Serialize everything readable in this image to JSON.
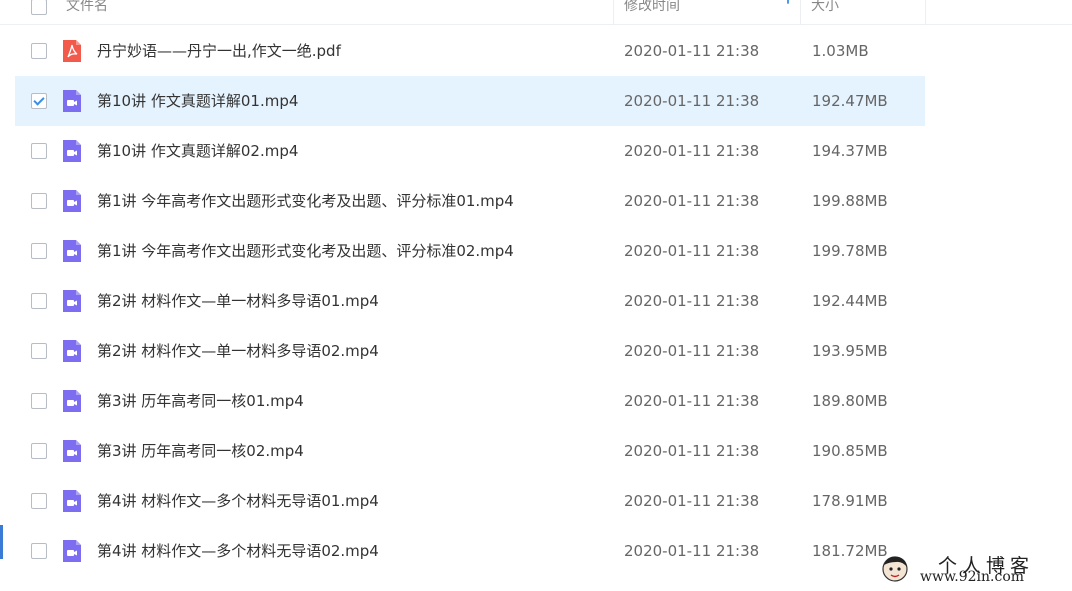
{
  "header": {
    "name_label": "文件名",
    "modified_label": "修改时间",
    "size_label": "大小"
  },
  "colors": {
    "selected_row": "#e5f3ff",
    "pdf_icon": "#f25a4c",
    "video_icon": "#7d6df0",
    "checkmark": "#3a8ee6"
  },
  "files": [
    {
      "name": "丹宁妙语——丹宁一出,作文一绝.pdf",
      "modified": "2020-01-11 21:38",
      "size": "1.03MB",
      "icon": "pdf-icon",
      "selected": false
    },
    {
      "name": "第10讲 作文真题详解01.mp4",
      "modified": "2020-01-11 21:38",
      "size": "192.47MB",
      "icon": "video-icon",
      "selected": true
    },
    {
      "name": "第10讲 作文真题详解02.mp4",
      "modified": "2020-01-11 21:38",
      "size": "194.37MB",
      "icon": "video-icon",
      "selected": false
    },
    {
      "name": "第1讲 今年高考作文出题形式变化考及出题、评分标准01.mp4",
      "modified": "2020-01-11 21:38",
      "size": "199.88MB",
      "icon": "video-icon",
      "selected": false
    },
    {
      "name": "第1讲 今年高考作文出题形式变化考及出题、评分标准02.mp4",
      "modified": "2020-01-11 21:38",
      "size": "199.78MB",
      "icon": "video-icon",
      "selected": false
    },
    {
      "name": "第2讲 材料作文—单一材料多导语01.mp4",
      "modified": "2020-01-11 21:38",
      "size": "192.44MB",
      "icon": "video-icon",
      "selected": false
    },
    {
      "name": "第2讲 材料作文—单一材料多导语02.mp4",
      "modified": "2020-01-11 21:38",
      "size": "193.95MB",
      "icon": "video-icon",
      "selected": false
    },
    {
      "name": "第3讲 历年高考同一核01.mp4",
      "modified": "2020-01-11 21:38",
      "size": "189.80MB",
      "icon": "video-icon",
      "selected": false
    },
    {
      "name": "第3讲 历年高考同一核02.mp4",
      "modified": "2020-01-11 21:38",
      "size": "190.85MB",
      "icon": "video-icon",
      "selected": false
    },
    {
      "name": "第4讲 材料作文—多个材料无导语01.mp4",
      "modified": "2020-01-11 21:38",
      "size": "178.91MB",
      "icon": "video-icon",
      "selected": false
    },
    {
      "name": "第4讲 材料作文—多个材料无导语02.mp4",
      "modified": "2020-01-11 21:38",
      "size": "181.72MB",
      "icon": "video-icon",
      "selected": false
    }
  ],
  "watermark": {
    "title": "个人博客",
    "url": "www.92in.com"
  }
}
